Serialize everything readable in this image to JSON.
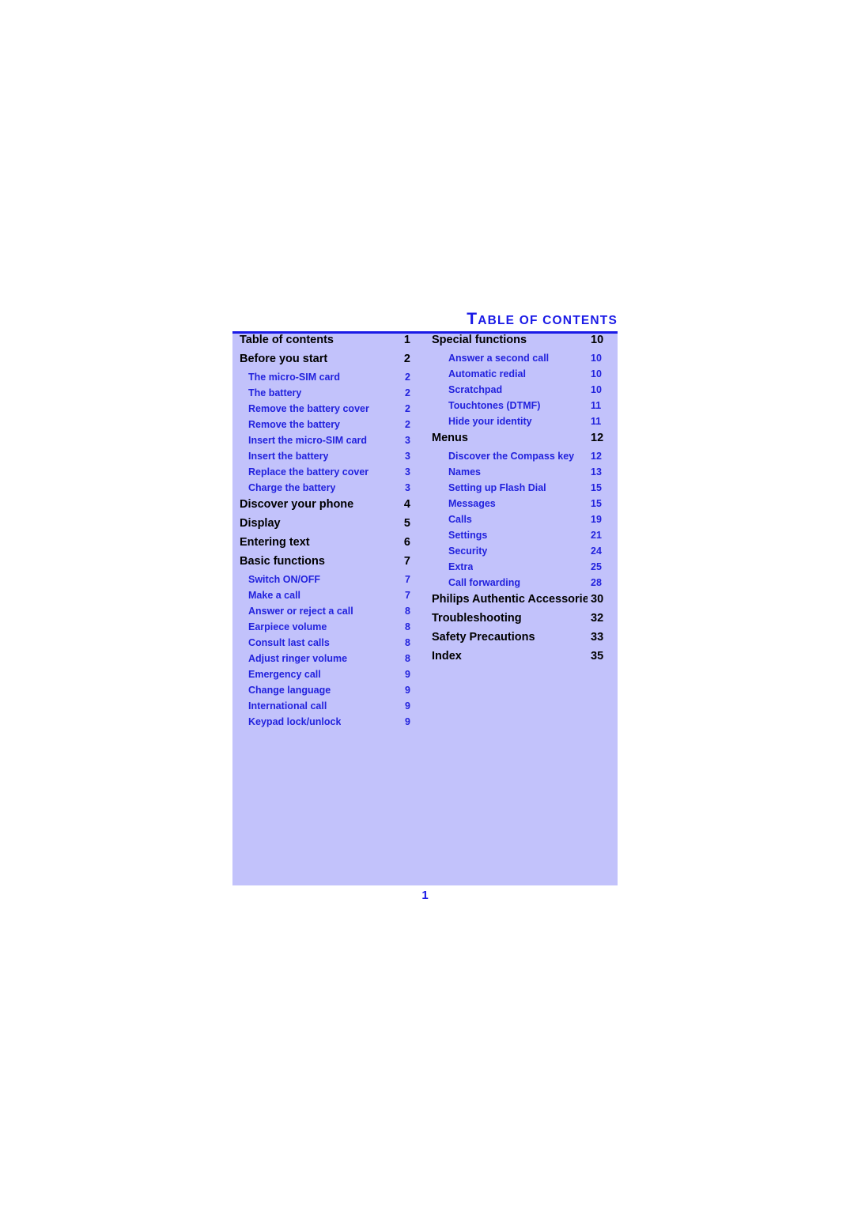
{
  "document": {
    "title": "TABLE OF CONTENTS",
    "title_first_letter": "T",
    "title_rest": "ABLE OF CONTENTS",
    "page_number": "1",
    "colors": {
      "panel_background": "#c2c2fb",
      "heading_blue": "#1a1ae6",
      "entry_black": "#000000",
      "sub_entry_blue": "#2222dd",
      "page_white": "#ffffff"
    }
  },
  "toc": {
    "left_column": [
      {
        "label": "Table of contents",
        "page": "1",
        "level": 1
      },
      {
        "label": "Before you start",
        "page": "2",
        "level": 1
      },
      {
        "label": "The micro-SIM card",
        "page": "2",
        "level": 2
      },
      {
        "label": "The battery",
        "page": "2",
        "level": 2
      },
      {
        "label": "Remove the battery cover",
        "page": "2",
        "level": 2
      },
      {
        "label": "Remove the battery",
        "page": "2",
        "level": 2
      },
      {
        "label": "Insert the micro-SIM card",
        "page": "3",
        "level": 2
      },
      {
        "label": "Insert the battery",
        "page": "3",
        "level": 2
      },
      {
        "label": "Replace the battery cover",
        "page": "3",
        "level": 2
      },
      {
        "label": "Charge the battery",
        "page": "3",
        "level": 2
      },
      {
        "label": "Discover your phone",
        "page": "4",
        "level": 1
      },
      {
        "label": "Display",
        "page": "5",
        "level": 1
      },
      {
        "label": "Entering text",
        "page": "6",
        "level": 1
      },
      {
        "label": "Basic functions",
        "page": "7",
        "level": 1
      },
      {
        "label": "Switch ON/OFF",
        "page": "7",
        "level": 2
      },
      {
        "label": "Make a call",
        "page": "7",
        "level": 2
      },
      {
        "label": "Answer or reject a call",
        "page": "8",
        "level": 2
      },
      {
        "label": "Earpiece volume",
        "page": "8",
        "level": 2
      },
      {
        "label": "Consult last calls",
        "page": "8",
        "level": 2
      },
      {
        "label": "Adjust ringer volume",
        "page": "8",
        "level": 2
      },
      {
        "label": "Emergency call",
        "page": "9",
        "level": 2
      },
      {
        "label": "Change language",
        "page": "9",
        "level": 2
      },
      {
        "label": "International call",
        "page": "9",
        "level": 2
      },
      {
        "label": "Keypad lock/unlock",
        "page": "9",
        "level": 2
      }
    ],
    "right_column": [
      {
        "label": "Special functions",
        "page": "10",
        "level": 1
      },
      {
        "label": "Answer a second call",
        "page": "10",
        "level": 2
      },
      {
        "label": "Automatic redial",
        "page": "10",
        "level": 2
      },
      {
        "label": "Scratchpad",
        "page": "10",
        "level": 2
      },
      {
        "label": "Touchtones (DTMF)",
        "page": "11",
        "level": 2
      },
      {
        "label": "Hide your identity",
        "page": "11",
        "level": 2
      },
      {
        "label": "Menus",
        "page": "12",
        "level": 1
      },
      {
        "label": "Discover the Compass key",
        "page": "12",
        "level": 2
      },
      {
        "label": "Names",
        "page": "13",
        "level": 2
      },
      {
        "label": "Setting up Flash Dial",
        "page": "15",
        "level": 2
      },
      {
        "label": "Messages",
        "page": "15",
        "level": 2
      },
      {
        "label": "Calls",
        "page": "19",
        "level": 2
      },
      {
        "label": "Settings",
        "page": "21",
        "level": 2
      },
      {
        "label": "Security",
        "page": "24",
        "level": 2
      },
      {
        "label": "Extra",
        "page": "25",
        "level": 2
      },
      {
        "label": "Call forwarding",
        "page": "28",
        "level": 2
      },
      {
        "label": "Philips Authentic Accessories",
        "page": "30",
        "level": 1
      },
      {
        "label": "Troubleshooting",
        "page": "32",
        "level": 1
      },
      {
        "label": "Safety Precautions",
        "page": "33",
        "level": 1
      },
      {
        "label": "Index",
        "page": "35",
        "level": 1
      }
    ]
  }
}
